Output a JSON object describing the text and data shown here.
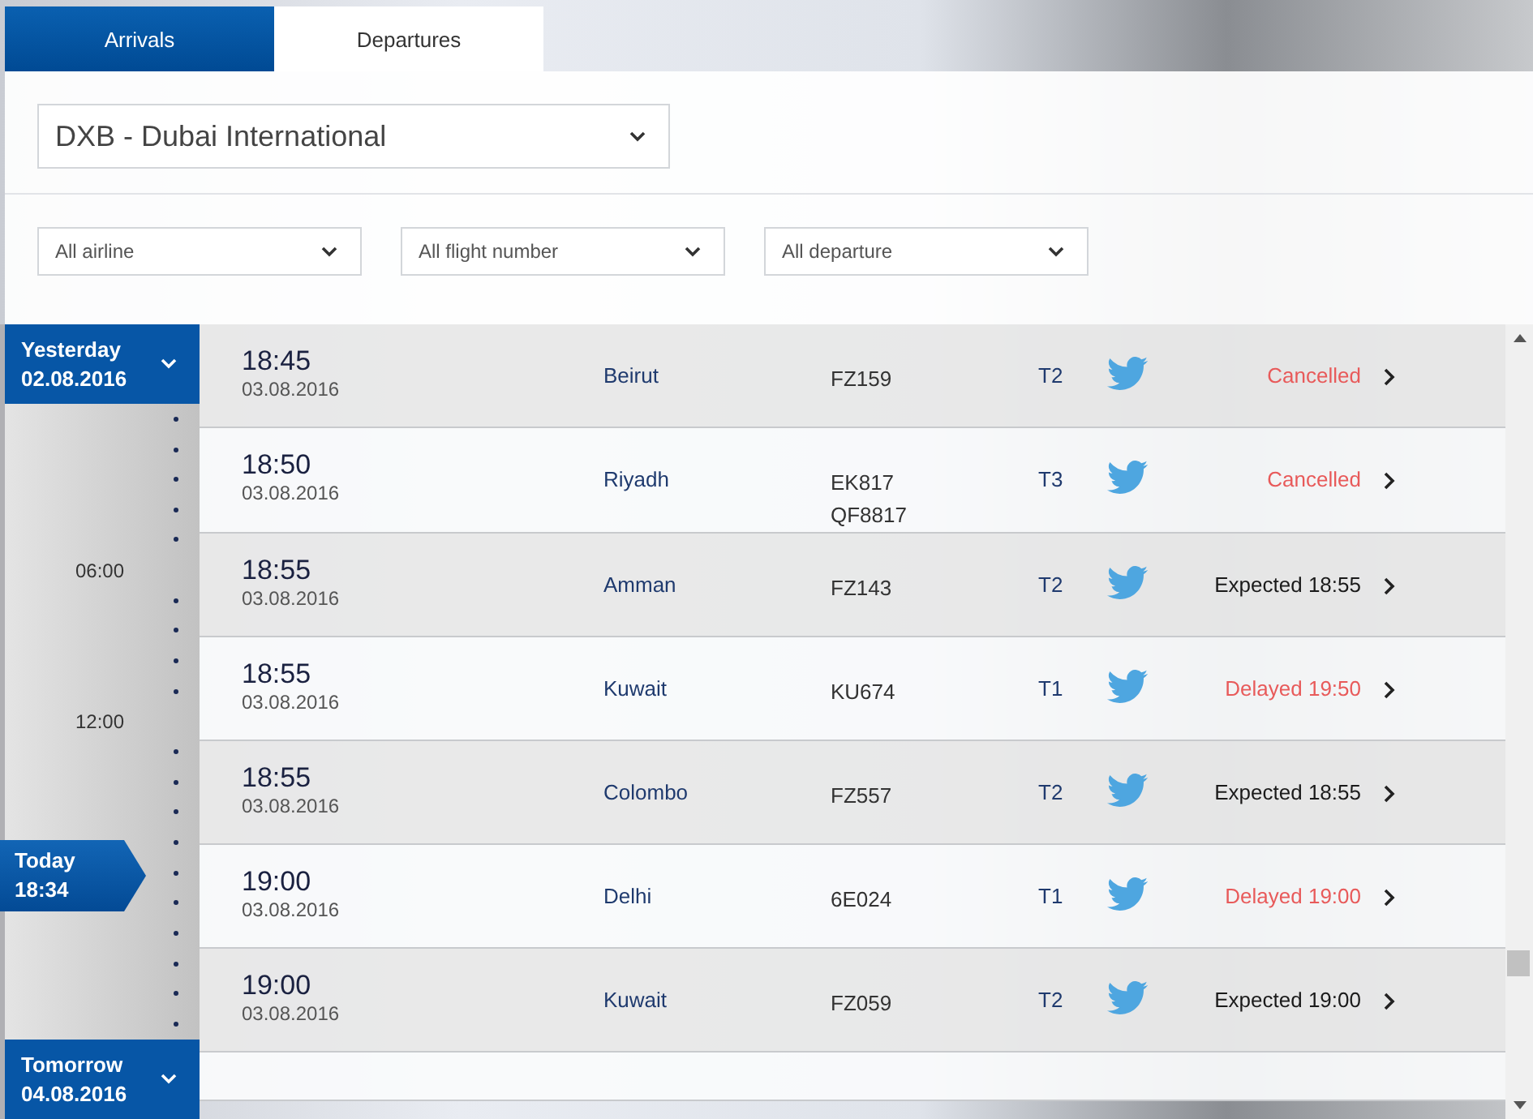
{
  "tabs": [
    {
      "label": "Arrivals",
      "selected": false
    },
    {
      "label": "Departures",
      "selected": true
    }
  ],
  "airport_select": {
    "value": "DXB - Dubai International"
  },
  "filters": [
    {
      "value": "All airline"
    },
    {
      "value": "All flight number"
    },
    {
      "value": "All departure"
    }
  ],
  "timeline": {
    "top": {
      "label": "Yesterday",
      "date": "02.08.2016"
    },
    "hours": [
      "06:00",
      "12:00"
    ],
    "now": {
      "label": "Today",
      "time": "18:34"
    },
    "bottom": {
      "label": "Tomorrow",
      "date": "04.08.2016"
    }
  },
  "flights": [
    {
      "time": "18:45",
      "date": "03.08.2016",
      "destination": "Beirut",
      "flight_numbers": [
        "FZ159"
      ],
      "terminal": "T2",
      "status": "Cancelled",
      "kind": "cancelled"
    },
    {
      "time": "18:50",
      "date": "03.08.2016",
      "destination": "Riyadh",
      "flight_numbers": [
        "EK817",
        "QF8817"
      ],
      "terminal": "T3",
      "status": "Cancelled",
      "kind": "cancelled"
    },
    {
      "time": "18:55",
      "date": "03.08.2016",
      "destination": "Amman",
      "flight_numbers": [
        "FZ143"
      ],
      "terminal": "T2",
      "status": "Expected 18:55",
      "kind": "expected"
    },
    {
      "time": "18:55",
      "date": "03.08.2016",
      "destination": "Kuwait",
      "flight_numbers": [
        "KU674"
      ],
      "terminal": "T1",
      "status": "Delayed 19:50",
      "kind": "delayed"
    },
    {
      "time": "18:55",
      "date": "03.08.2016",
      "destination": "Colombo",
      "flight_numbers": [
        "FZ557"
      ],
      "terminal": "T2",
      "status": "Expected 18:55",
      "kind": "expected"
    },
    {
      "time": "19:00",
      "date": "03.08.2016",
      "destination": "Delhi",
      "flight_numbers": [
        "6E024"
      ],
      "terminal": "T1",
      "status": "Delayed 19:00",
      "kind": "delayed"
    },
    {
      "time": "19:00",
      "date": "03.08.2016",
      "destination": "Kuwait",
      "flight_numbers": [
        "FZ059"
      ],
      "terminal": "T2",
      "status": "Expected 19:00",
      "kind": "expected"
    }
  ]
}
